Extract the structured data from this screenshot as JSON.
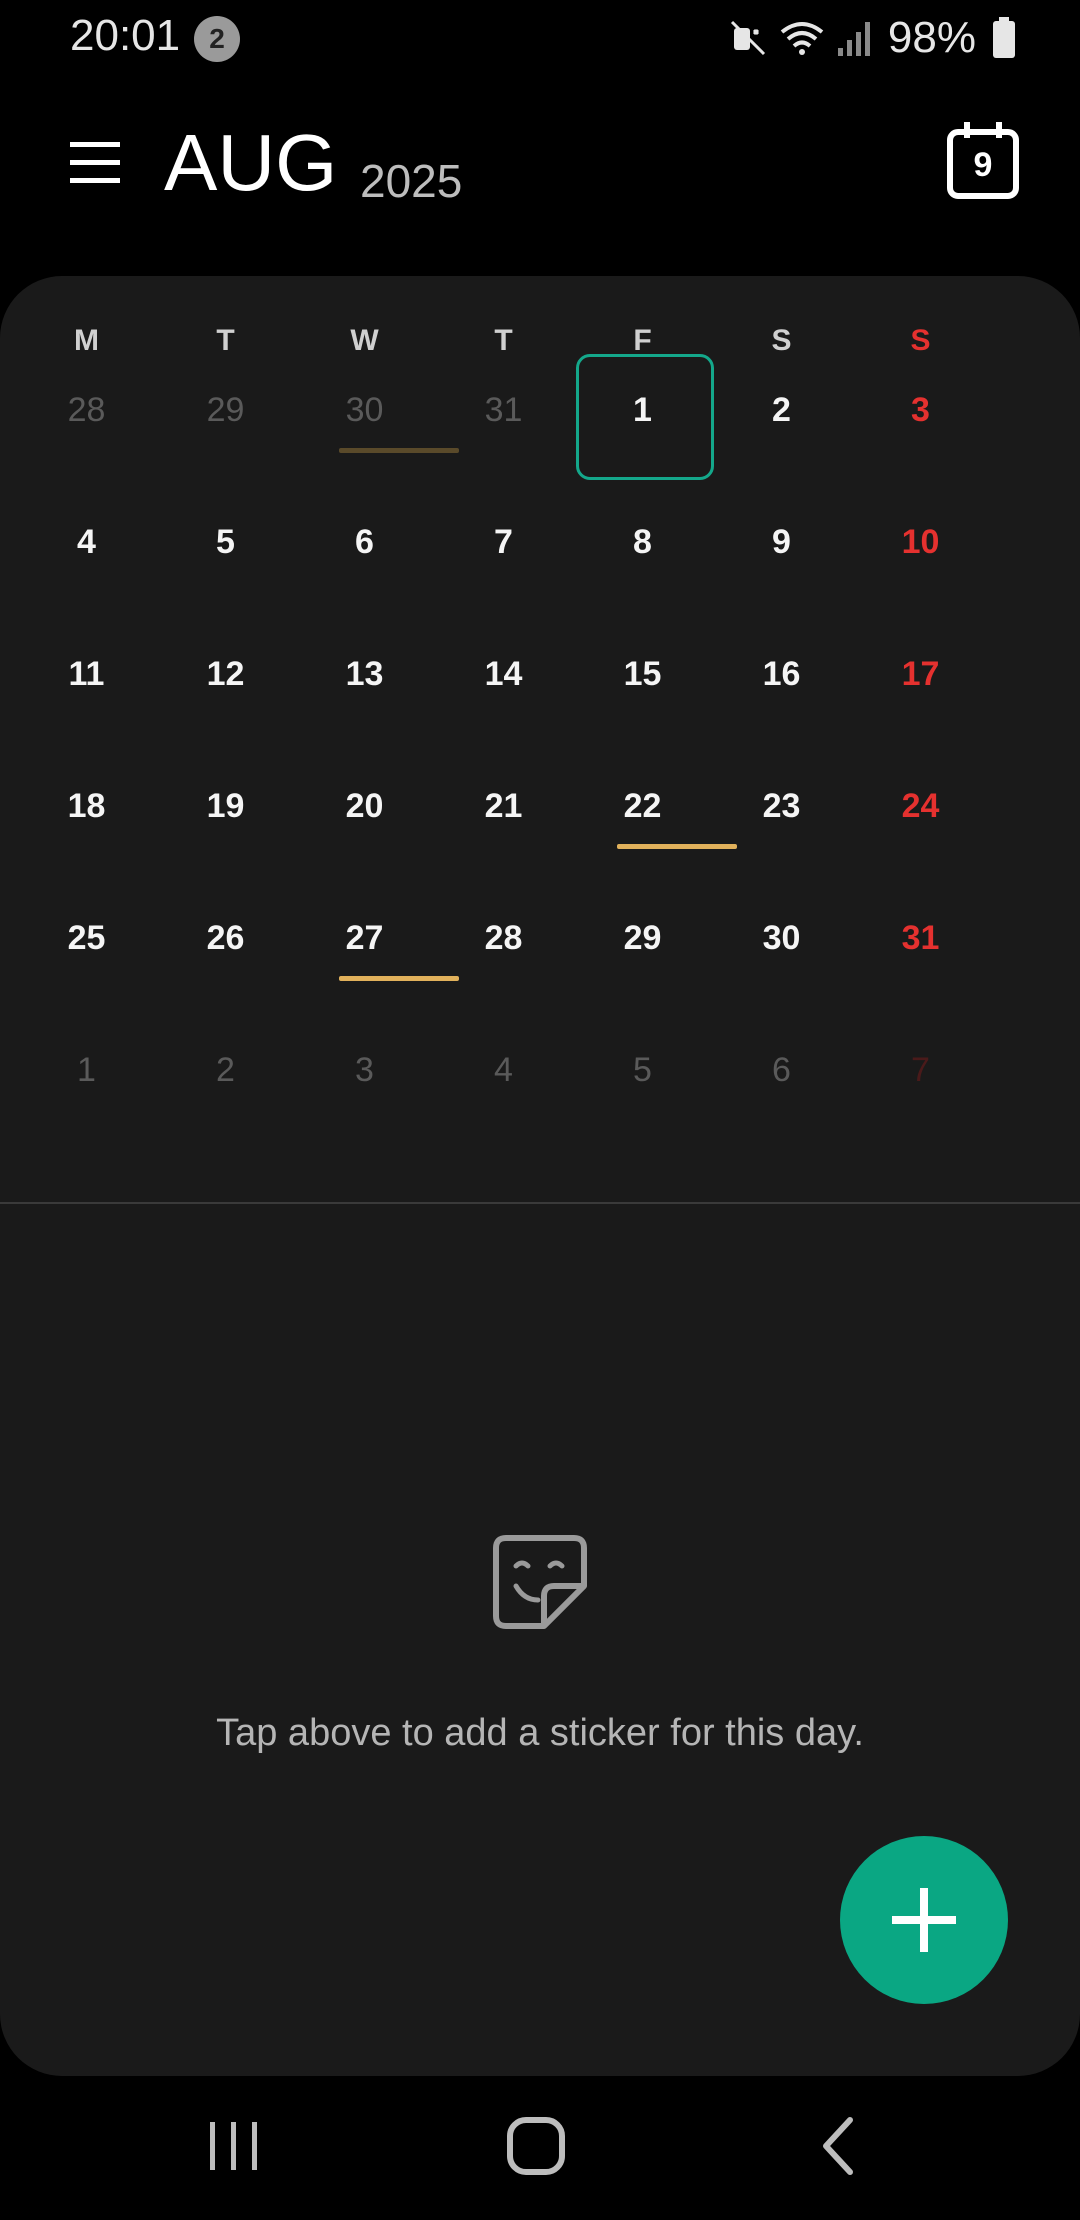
{
  "status_bar": {
    "time": "20:01",
    "notification_count": "2",
    "battery": "98%",
    "icons": [
      "mute-icon",
      "wifi-icon",
      "signal-icon",
      "battery-icon"
    ]
  },
  "header": {
    "month": "AUG",
    "year": "2025",
    "today_button": "9"
  },
  "calendar": {
    "weekdays": [
      "M",
      "T",
      "W",
      "T",
      "F",
      "S",
      "S"
    ],
    "weeks": [
      [
        {
          "d": "28",
          "o": true
        },
        {
          "d": "29",
          "o": true
        },
        {
          "d": "30",
          "o": true,
          "ev": true
        },
        {
          "d": "31",
          "o": true
        },
        {
          "d": "1",
          "sel": true
        },
        {
          "d": "2"
        },
        {
          "d": "3"
        }
      ],
      [
        {
          "d": "4"
        },
        {
          "d": "5"
        },
        {
          "d": "6"
        },
        {
          "d": "7"
        },
        {
          "d": "8"
        },
        {
          "d": "9"
        },
        {
          "d": "10"
        }
      ],
      [
        {
          "d": "11"
        },
        {
          "d": "12"
        },
        {
          "d": "13"
        },
        {
          "d": "14"
        },
        {
          "d": "15"
        },
        {
          "d": "16"
        },
        {
          "d": "17"
        }
      ],
      [
        {
          "d": "18"
        },
        {
          "d": "19"
        },
        {
          "d": "20"
        },
        {
          "d": "21"
        },
        {
          "d": "22",
          "ev": true
        },
        {
          "d": "23"
        },
        {
          "d": "24"
        }
      ],
      [
        {
          "d": "25"
        },
        {
          "d": "26"
        },
        {
          "d": "27",
          "ev": true
        },
        {
          "d": "28"
        },
        {
          "d": "29"
        },
        {
          "d": "30"
        },
        {
          "d": "31"
        }
      ],
      [
        {
          "d": "1",
          "o": true
        },
        {
          "d": "2",
          "o": true
        },
        {
          "d": "3",
          "o": true
        },
        {
          "d": "4",
          "o": true
        },
        {
          "d": "5",
          "o": true
        },
        {
          "d": "6",
          "o": true
        },
        {
          "d": "7",
          "o": true
        }
      ]
    ]
  },
  "empty_state": {
    "icon": "sticker-icon",
    "message": "Tap above to add a sticker for this day."
  },
  "colors": {
    "accent": "#0aa783",
    "sunday": "#e5312f",
    "event_bar": "#e1b15b"
  }
}
